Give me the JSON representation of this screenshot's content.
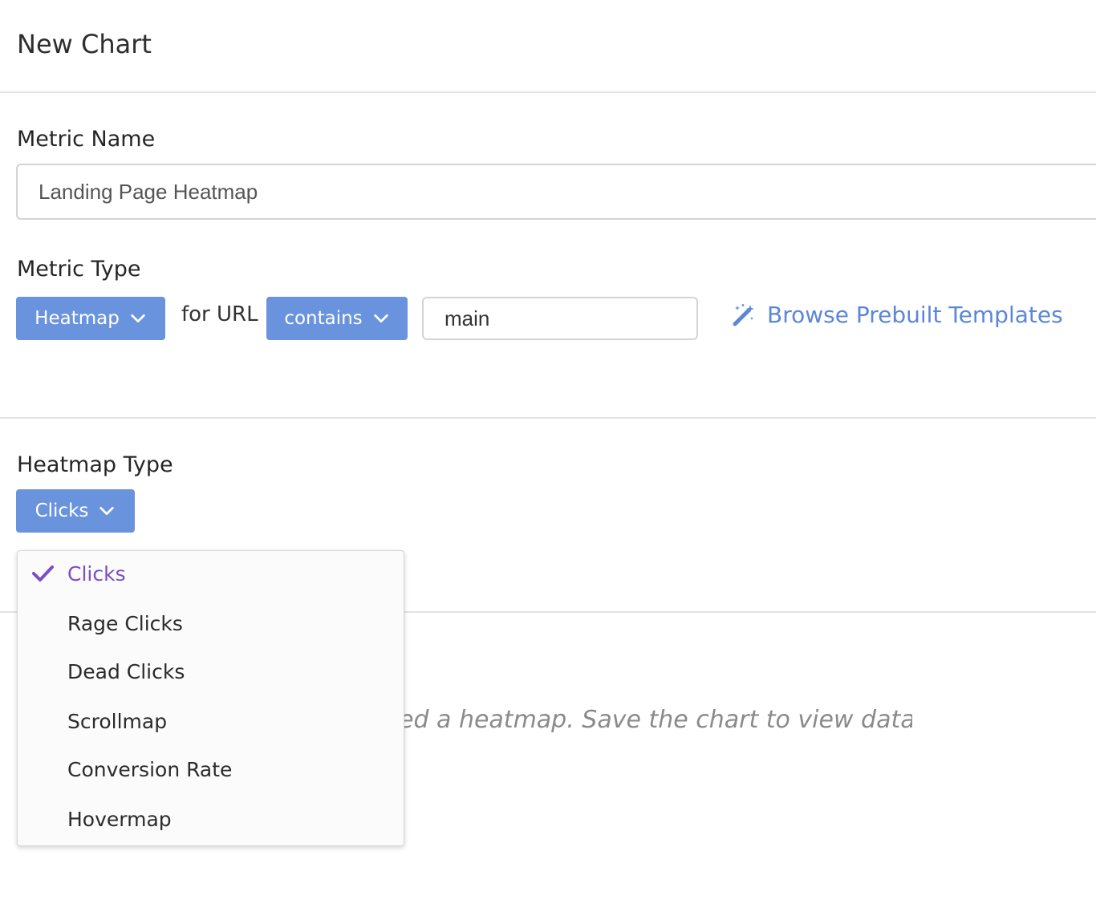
{
  "page": {
    "title": "New Chart"
  },
  "metric_name": {
    "label": "Metric Name",
    "value": "Landing Page Heatmap"
  },
  "metric_type": {
    "label": "Metric Type",
    "type_button": "Heatmap",
    "for_url": "for URL",
    "match_button": "contains",
    "url_value": "main",
    "templates_link": "Browse Prebuilt Templates"
  },
  "heatmap_type": {
    "label": "Heatmap Type",
    "selected": "Clicks",
    "options": [
      {
        "label": "Clicks",
        "selected": true
      },
      {
        "label": "Rage Clicks",
        "selected": false
      },
      {
        "label": "Dead Clicks",
        "selected": false
      },
      {
        "label": "Scrollmap",
        "selected": false
      },
      {
        "label": "Conversion Rate",
        "selected": false
      },
      {
        "label": "Hovermap",
        "selected": false
      }
    ]
  },
  "empty_state": {
    "message": "ed a heatmap. Save the chart to view data."
  },
  "colors": {
    "button": "#6a93dd",
    "link": "#5b87d6",
    "selected_option": "#7a4fc5"
  },
  "icons": {
    "dropdown": "chevron-down-icon",
    "templates": "magic-wand-icon",
    "selected_option": "checkmark-icon"
  }
}
